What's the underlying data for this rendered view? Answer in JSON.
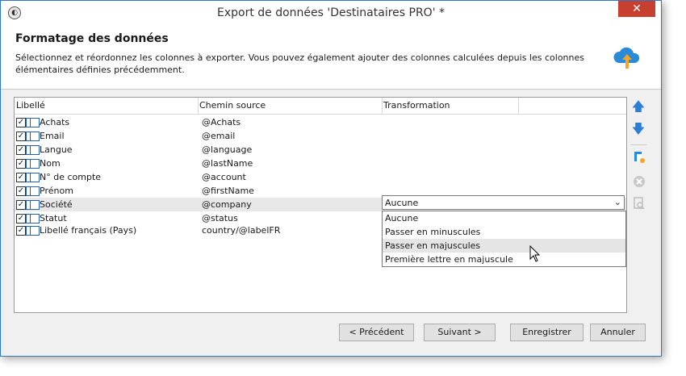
{
  "window": {
    "title": "Export de données 'Destinataires PRO' *",
    "close_label": "✕"
  },
  "header": {
    "title": "Formatage des données",
    "description": "Sélectionnez et réordonnez les colonnes à exporter. Vous pouvez également ajouter des colonnes calculées depuis les colonnes élémentaires définies précédemment."
  },
  "grid": {
    "columns": [
      "Libellé",
      "Chemin source",
      "Transformation"
    ],
    "rows": [
      {
        "label": "Achats",
        "source": "@Achats",
        "checked": true
      },
      {
        "label": "Email",
        "source": "@email",
        "checked": true
      },
      {
        "label": "Langue",
        "source": "@language",
        "checked": true
      },
      {
        "label": "Nom",
        "source": "@lastName",
        "checked": true
      },
      {
        "label": "N° de compte",
        "source": "@account",
        "checked": true
      },
      {
        "label": "Prénom",
        "source": "@firstName",
        "checked": true
      },
      {
        "label": "Société",
        "source": "@company",
        "checked": true
      },
      {
        "label": "Statut",
        "source": "@status",
        "checked": true
      },
      {
        "label": "Libellé français (Pays)",
        "source": "country/@labelFR",
        "checked": true
      }
    ],
    "selected_row": 6
  },
  "transformation": {
    "value": "Aucune",
    "options": [
      "Aucune",
      "Passer en minuscules",
      "Passer en majuscules",
      "Première lettre en majuscule"
    ],
    "hovered_option": 2
  },
  "buttons": {
    "previous": "< Précédent",
    "next": "Suivant >",
    "save": "Enregistrer",
    "cancel": "Annuler"
  },
  "colors": {
    "accent": "#1e63b8",
    "close": "#c7402f"
  }
}
